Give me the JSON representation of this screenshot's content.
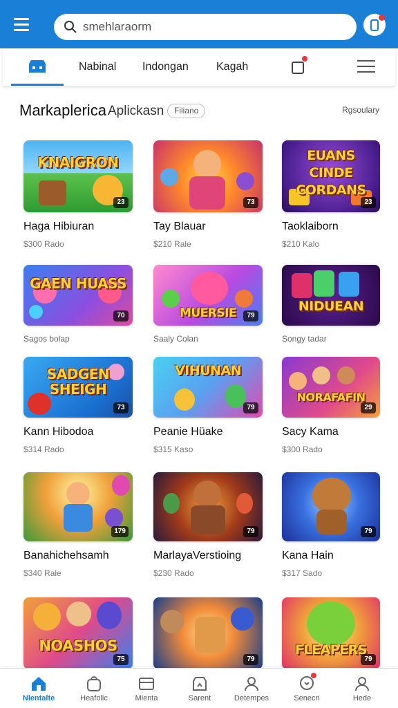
{
  "colors": {
    "accent": "#1a7fd6",
    "badge_red": "#e23b3b"
  },
  "header": {
    "menu_icon": "hamburger-icon",
    "search_placeholder": "smehlaraorm",
    "search_icon": "search-icon",
    "action_icon": "phone-icon"
  },
  "tabs": {
    "home_icon": "store-icon",
    "items": [
      "Nabinal",
      "Indongan",
      "Kagah"
    ],
    "bag_icon": "shopping-bag-icon",
    "menu_icon": "menu-icon"
  },
  "section": {
    "title": "Markaplerica",
    "subtitle": "Aplickasn",
    "chip": "Filiano",
    "link": "Rgsoulary"
  },
  "grid": [
    {
      "thumb_text": "KNAIGRON",
      "badge": "23",
      "name": "Haga Hibiuran",
      "price": "$300 Rado"
    },
    {
      "thumb_text": "",
      "badge": "73",
      "name": "Tay Blauar",
      "price": "$210 Rale"
    },
    {
      "thumb_text": "EUANS CINDE CORDANS",
      "badge": "23",
      "name": "Taoklaiborn",
      "price": "$210 Kalo"
    },
    {
      "thumb_text": "GAEN HUASS",
      "badge": "70",
      "name": "",
      "price": "",
      "sub": "Sagos bolap"
    },
    {
      "thumb_text": "MUERSIE",
      "badge": "79",
      "name": "",
      "price": "",
      "sub": "Saaly Colan"
    },
    {
      "thumb_text": "NIDUEAN",
      "badge": "",
      "name": "",
      "price": "",
      "sub": "Songy tadar"
    },
    {
      "thumb_text": "SADGEN SHEIGH",
      "badge": "73",
      "name": "Kann Hibodoa",
      "price": "$314 Rado"
    },
    {
      "thumb_text": "VIHUNAN",
      "badge": "79",
      "name": "Peanie Hüake",
      "price": "$315 Kaso"
    },
    {
      "thumb_text": "NORAFAFIN",
      "badge": "29",
      "name": "Sacy Kama",
      "price": "$300 Rado"
    },
    {
      "thumb_text": "",
      "badge": "179",
      "name": "Banahichehsamh",
      "price": "$340 Rale"
    },
    {
      "thumb_text": "",
      "badge": "79",
      "name": "MarlayaVerstioing",
      "price": "$230 Rado"
    },
    {
      "thumb_text": "",
      "badge": "79",
      "name": "Kana Hain",
      "price": "$317 Sado"
    },
    {
      "thumb_text": "NOASHOS",
      "badge": "75",
      "name": "",
      "price": ""
    },
    {
      "thumb_text": "",
      "badge": "79",
      "name": "",
      "price": ""
    },
    {
      "thumb_text": "FLEAPERS",
      "badge": "79",
      "name": "",
      "price": ""
    }
  ],
  "bottom_nav": [
    {
      "label": "Nlentalte",
      "icon": "home-icon"
    },
    {
      "label": "Heafolic",
      "icon": "bag-icon"
    },
    {
      "label": "Mienta",
      "icon": "wallet-icon"
    },
    {
      "label": "Sarent",
      "icon": "store-icon"
    },
    {
      "label": "Detempes",
      "icon": "user-icon"
    },
    {
      "label": "Senecn",
      "icon": "chat-icon"
    },
    {
      "label": "Hede",
      "icon": "profile-icon"
    }
  ]
}
